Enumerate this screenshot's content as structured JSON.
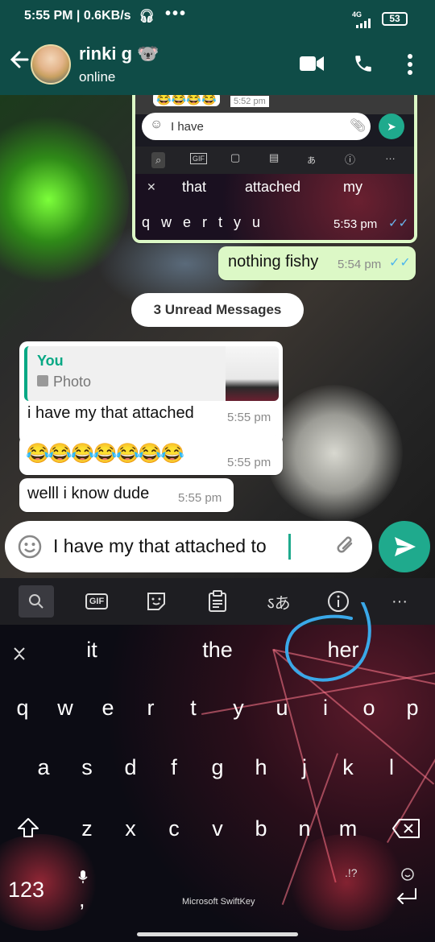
{
  "status_bar": {
    "time_speed": "5:55 PM | 0.6KB/s",
    "network": "4G",
    "battery": "53"
  },
  "header": {
    "contact_name": "rinki g 🐨",
    "presence": "online"
  },
  "quoted_screenshot": {
    "emoji_row": "😂😂😂😂",
    "emoji_time": "5:52 pm",
    "input_text": "I have",
    "suggestions": [
      "that",
      "attached",
      "my"
    ],
    "keys": [
      "q",
      "w",
      "e",
      "r",
      "t",
      "y",
      "u"
    ],
    "time": "5:53 pm"
  },
  "messages": [
    {
      "text": "nothing fishy",
      "time": "5:54 pm",
      "direction": "out"
    },
    {
      "reply_author": "You",
      "reply_label": "Photo",
      "text": "i have my that attached",
      "time": "5:55 pm",
      "direction": "in"
    },
    {
      "text": "😂😂😂😂😂😂😂",
      "time": "5:55 pm",
      "direction": "in"
    },
    {
      "text": "welll i know dude",
      "time": "5:55 pm",
      "direction": "in"
    }
  ],
  "unread_banner": "3 Unread Messages",
  "composer": {
    "text": "I have my that attached to"
  },
  "keyboard_toolbar": {
    "gif_label": "GIF"
  },
  "keyboard": {
    "suggestions": [
      "it",
      "the",
      "her"
    ],
    "row1": [
      "q",
      "w",
      "e",
      "r",
      "t",
      "y",
      "u",
      "i",
      "o",
      "p"
    ],
    "row2": [
      "a",
      "s",
      "d",
      "f",
      "g",
      "h",
      "j",
      "k",
      "l"
    ],
    "row3": [
      "z",
      "x",
      "c",
      "v",
      "b",
      "n",
      "m"
    ],
    "numbers_key": "123",
    "comma_key": ",",
    "punct_key": ".!?",
    "brand": "Microsoft SwiftKey"
  },
  "colors": {
    "header": "#0f4c47",
    "send": "#1faa8d",
    "out_bubble": "#dcf8c6",
    "annotation": "#3aa8e8"
  }
}
